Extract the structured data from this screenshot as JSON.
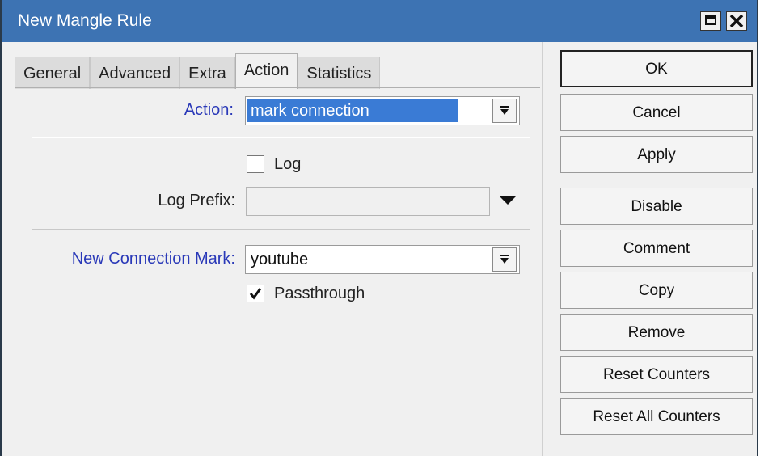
{
  "window": {
    "title": "New Mangle Rule",
    "maximize_icon": "maximize-icon",
    "close_icon": "close-icon"
  },
  "tabs": [
    {
      "label": "General",
      "active": false
    },
    {
      "label": "Advanced",
      "active": false
    },
    {
      "label": "Extra",
      "active": false
    },
    {
      "label": "Action",
      "active": true
    },
    {
      "label": "Statistics",
      "active": false
    }
  ],
  "form": {
    "action_label": "Action:",
    "action_value": "mark connection",
    "log_label": "Log",
    "log_checked": false,
    "log_prefix_label": "Log Prefix:",
    "log_prefix_value": "",
    "new_connection_mark_label": "New Connection Mark:",
    "new_connection_mark_value": "youtube",
    "passthrough_label": "Passthrough",
    "passthrough_checked": true
  },
  "buttons": {
    "ok": "OK",
    "cancel": "Cancel",
    "apply": "Apply",
    "disable": "Disable",
    "comment": "Comment",
    "copy": "Copy",
    "remove": "Remove",
    "reset_counters": "Reset Counters",
    "reset_all_counters": "Reset All Counters"
  },
  "colors": {
    "titlebar": "#3d73b3",
    "selection": "#3a7bd5",
    "field_label_blue": "#2a39b8"
  }
}
